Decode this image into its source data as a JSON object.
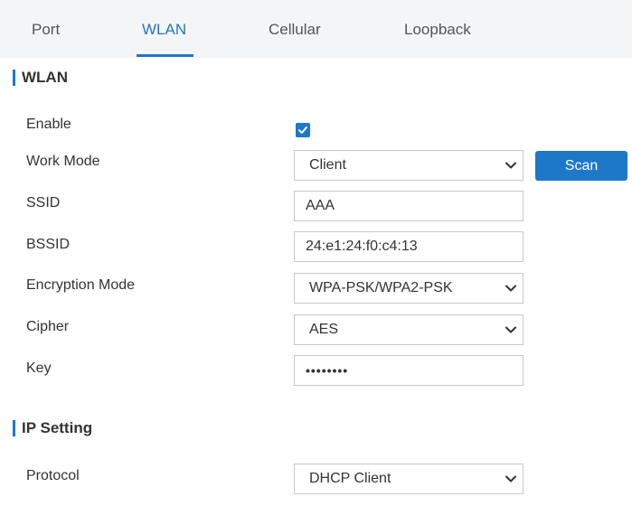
{
  "tabs": [
    {
      "label": "Port",
      "active": false
    },
    {
      "label": "WLAN",
      "active": true
    },
    {
      "label": "Cellular",
      "active": false
    },
    {
      "label": "Loopback",
      "active": false
    }
  ],
  "accent_color": "#1e78c8",
  "sections": {
    "wlan": {
      "title": "WLAN"
    },
    "ip_setting": {
      "title": "IP Setting"
    }
  },
  "form": {
    "enable": {
      "label": "Enable",
      "checked": true
    },
    "work_mode": {
      "label": "Work Mode",
      "value": "Client"
    },
    "scan_button": {
      "label": "Scan"
    },
    "ssid": {
      "label": "SSID",
      "value": "AAA"
    },
    "bssid": {
      "label": "BSSID",
      "value": "24:e1:24:f0:c4:13"
    },
    "encryption_mode": {
      "label": "Encryption Mode",
      "value": "WPA-PSK/WPA2-PSK"
    },
    "cipher": {
      "label": "Cipher",
      "value": "AES"
    },
    "key": {
      "label": "Key",
      "value": "••••••••"
    },
    "protocol": {
      "label": "Protocol",
      "value": "DHCP Client"
    }
  },
  "icons": {
    "checkbox": "checkmark-icon",
    "select": "chevron-down-icon"
  }
}
